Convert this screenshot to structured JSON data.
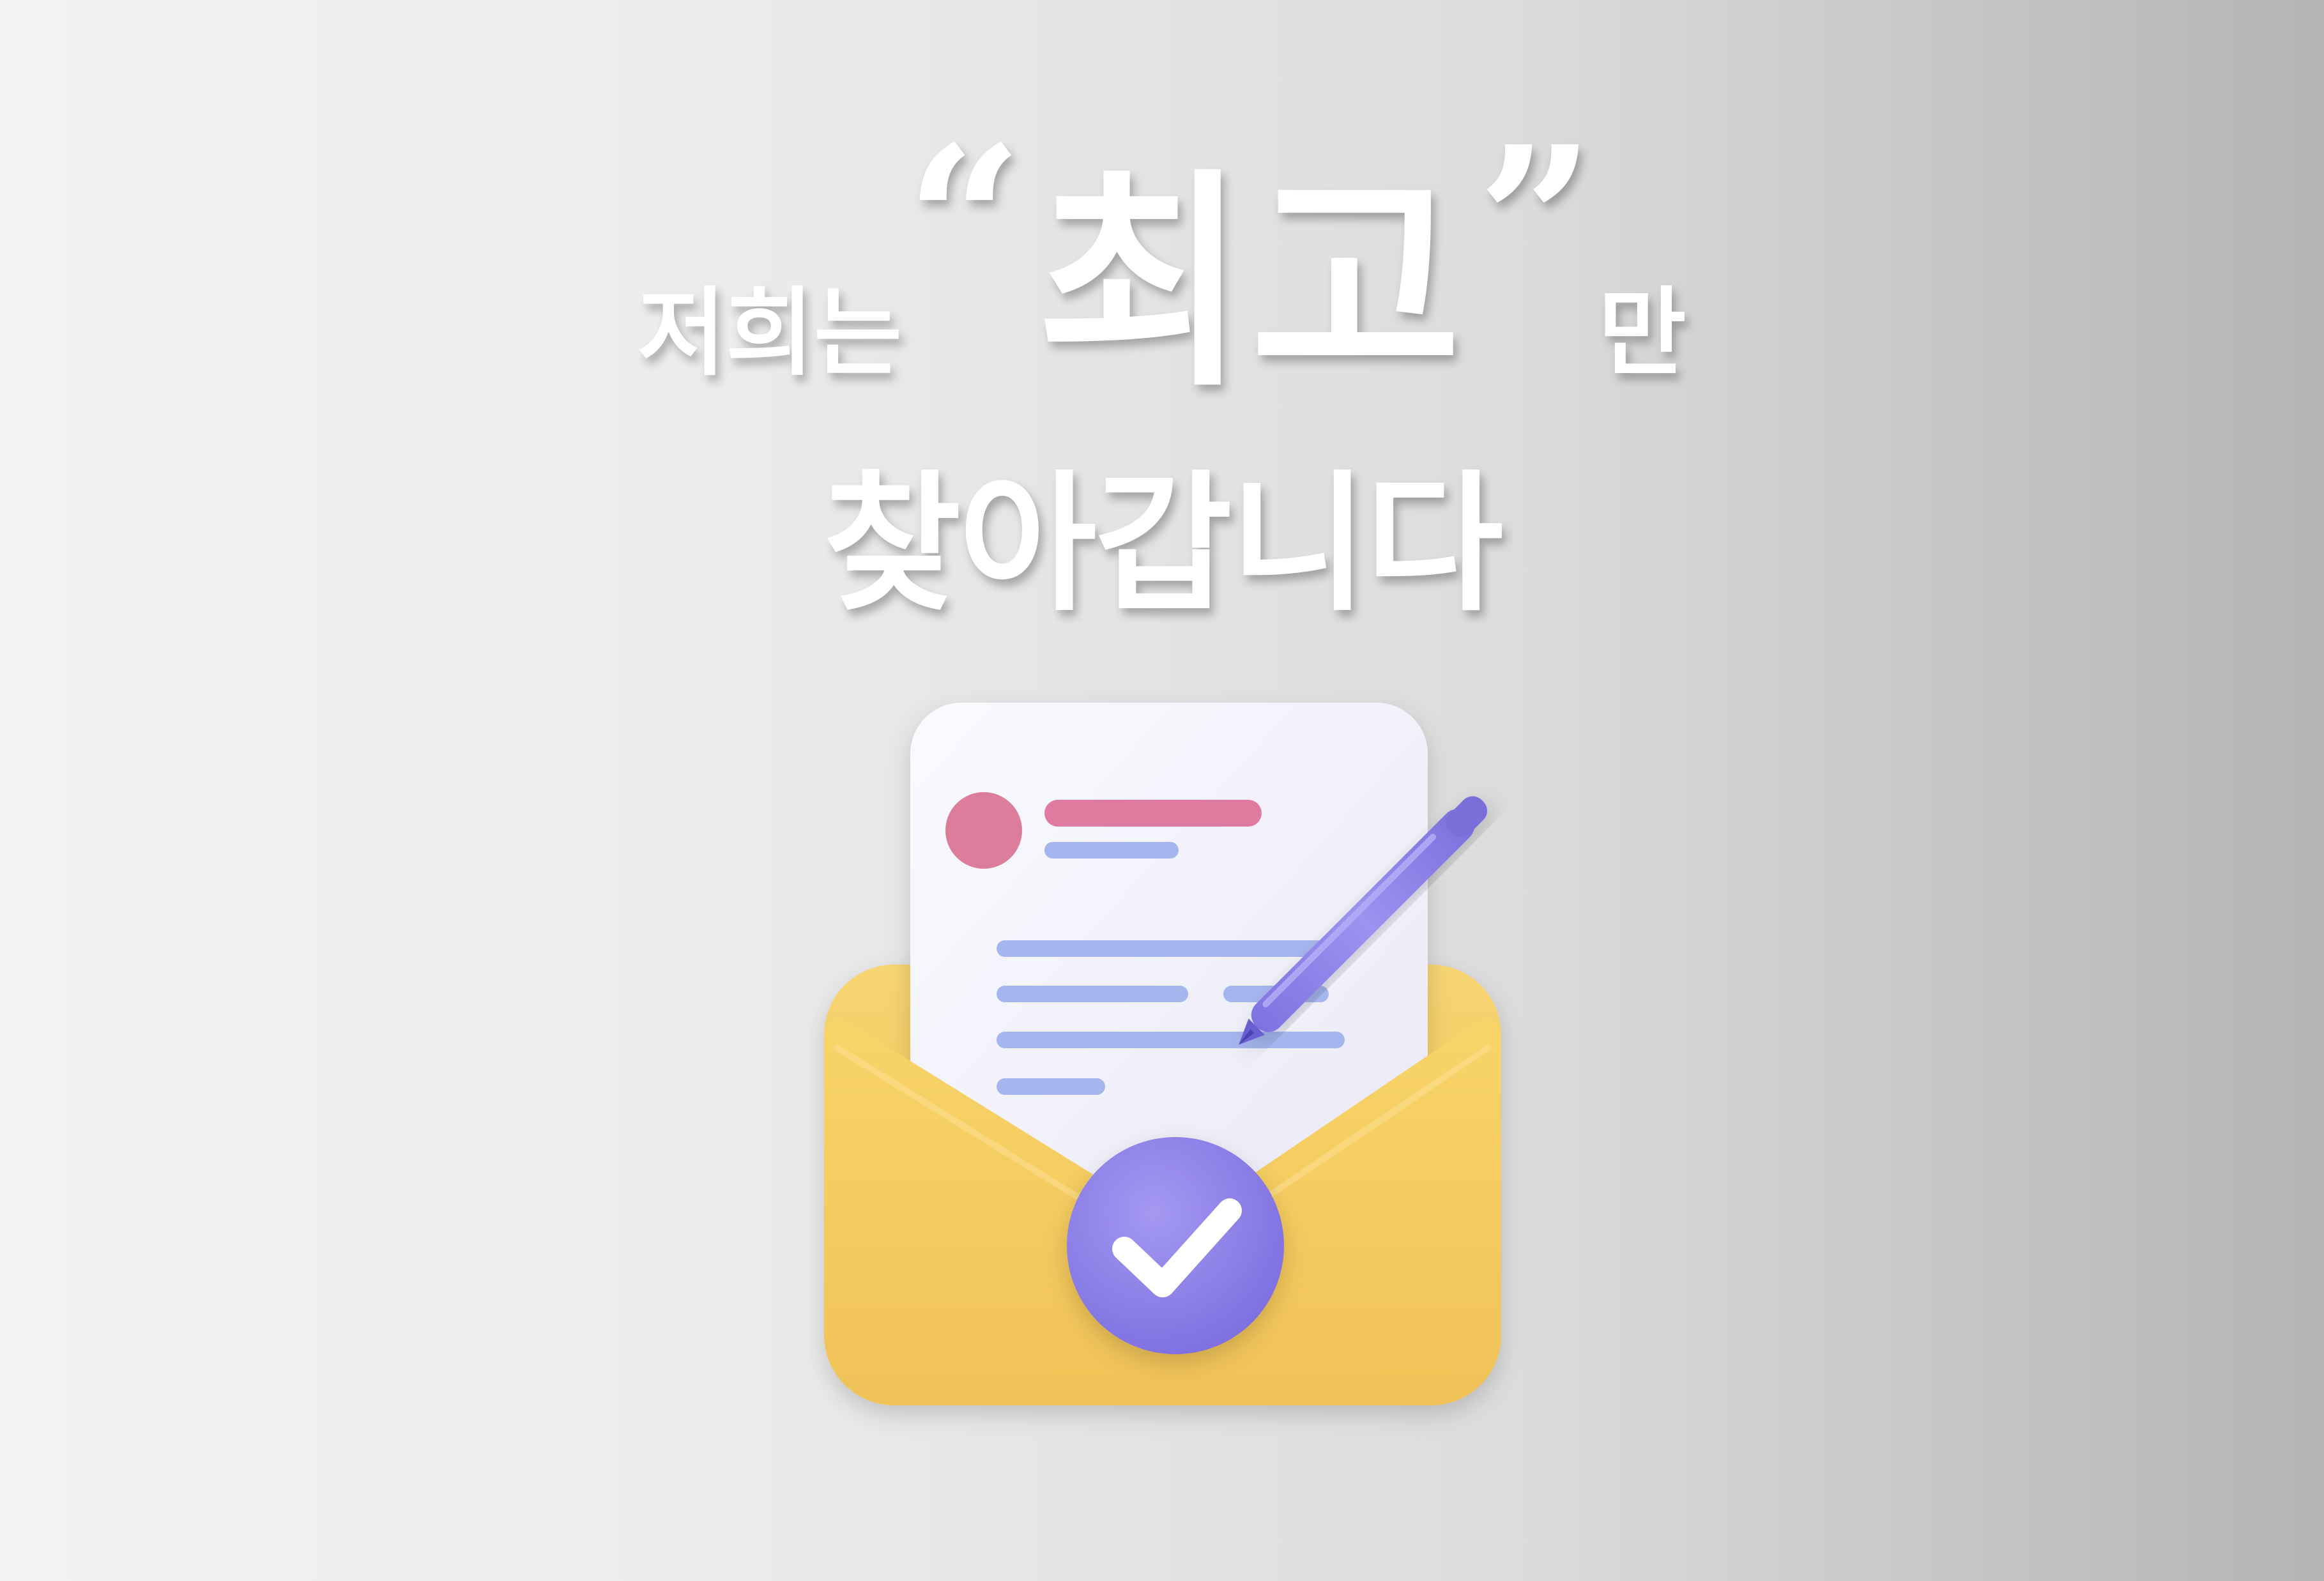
{
  "headline": {
    "prefix": "저희는",
    "open_quote": "“",
    "emphasis": "최고",
    "close_quote": "”",
    "suffix": "만",
    "line2": "찾아갑니다"
  },
  "illustration": {
    "icon": "envelope-document-pen-checkmark-icon",
    "colors": {
      "envelope": "#f4c95d",
      "paper": "#f1f0fb",
      "pen": "#8c80e8",
      "badge": "#8a7ce6",
      "avatar": "#dd7d9c",
      "title_line": "#e07ba0",
      "text_lines": "#a5b6ee"
    }
  }
}
